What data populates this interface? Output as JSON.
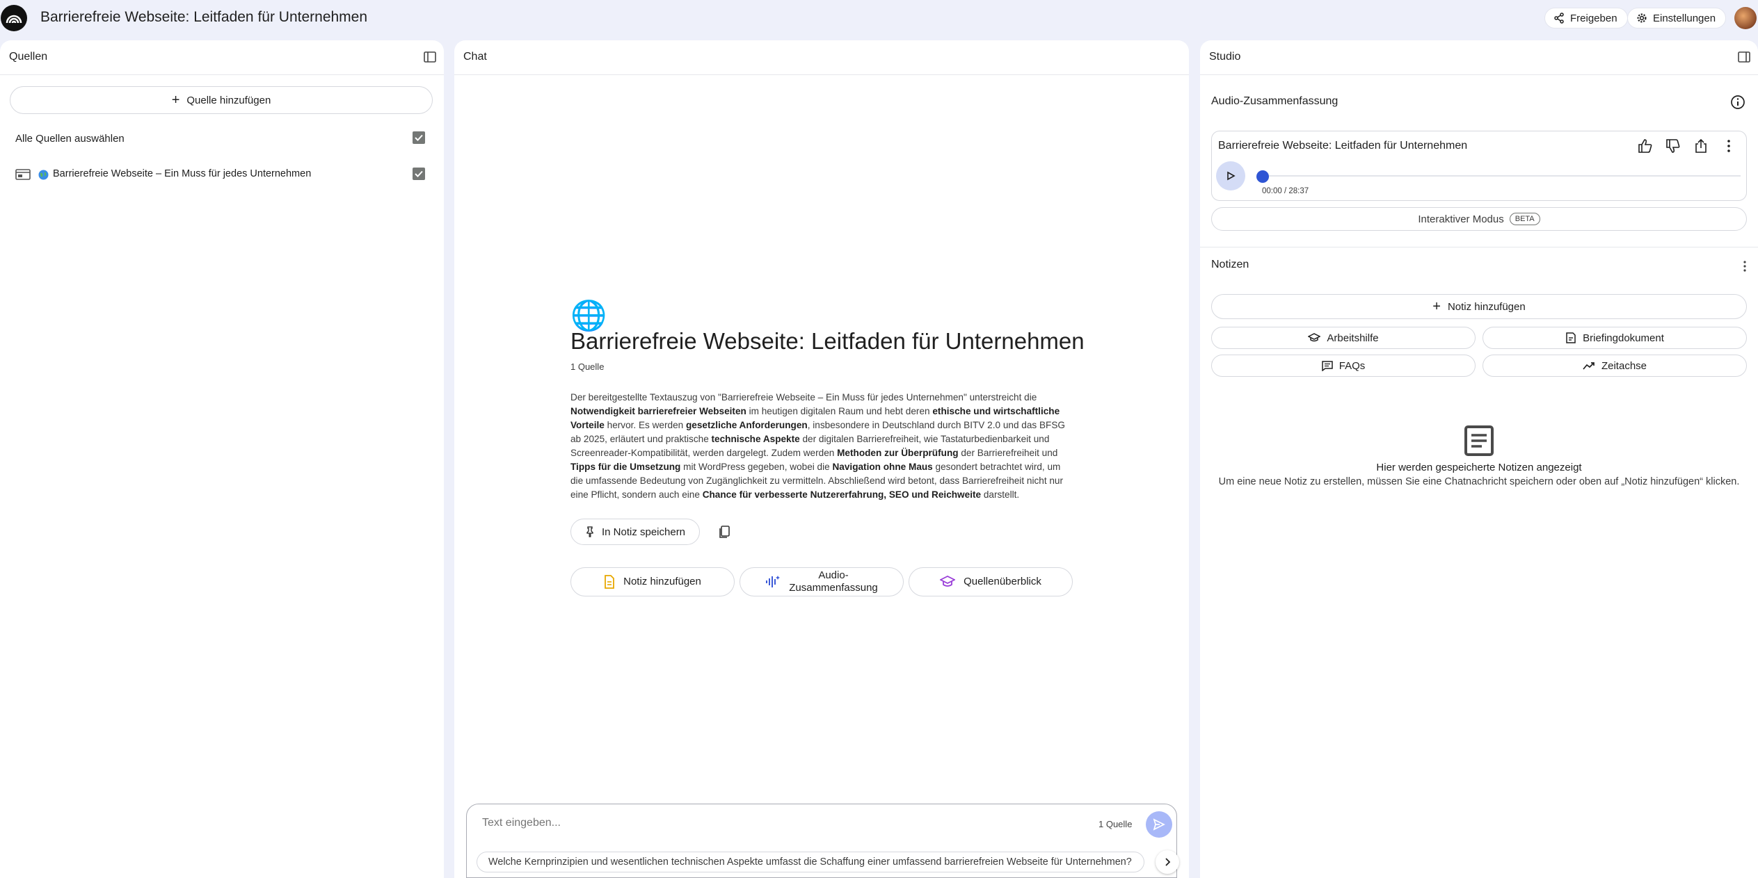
{
  "header": {
    "title": "Barrierefreie Webseite: Leitfaden für Unternehmen",
    "share_label": "Freigeben",
    "settings_label": "Einstellungen"
  },
  "sources": {
    "title": "Quellen",
    "add_label": "Quelle hinzufügen",
    "select_all_label": "Alle Quellen auswählen",
    "items": [
      {
        "label": "Barrierefreie Webseite – Ein Muss für jedes Unternehmen",
        "checked": true
      }
    ]
  },
  "chat": {
    "title": "Chat",
    "notebook_title": "Barrierefreie Webseite: Leitfaden für Unternehmen",
    "source_count": "1 Quelle",
    "summary_parts": [
      {
        "t": "Der bereitgestellte Textauszug von \"Barrierefreie Webseite – Ein Muss für jedes Unternehmen\" unterstreicht die ",
        "b": false
      },
      {
        "t": "Notwendigkeit barrierefreier Webseiten",
        "b": true
      },
      {
        "t": " im heutigen digitalen Raum und hebt deren ",
        "b": false
      },
      {
        "t": "ethische und wirtschaftliche Vorteile",
        "b": true
      },
      {
        "t": " hervor. Es werden ",
        "b": false
      },
      {
        "t": "gesetzliche Anforderungen",
        "b": true
      },
      {
        "t": ", insbesondere in Deutschland durch BITV 2.0 und das BFSG ab 2025, erläutert und praktische ",
        "b": false
      },
      {
        "t": "technische Aspekte",
        "b": true
      },
      {
        "t": " der digitalen Barrierefreiheit, wie Tastaturbedienbarkeit und Screenreader-Kompatibilität, werden dargelegt. Zudem werden ",
        "b": false
      },
      {
        "t": "Methoden zur Überprüfung",
        "b": true
      },
      {
        "t": " der Barrierefreiheit und ",
        "b": false
      },
      {
        "t": "Tipps für die Umsetzung",
        "b": true
      },
      {
        "t": " mit WordPress gegeben, wobei die ",
        "b": false
      },
      {
        "t": "Navigation ohne Maus",
        "b": true
      },
      {
        "t": " gesondert betrachtet wird, um die umfassende Bedeutung von Zugänglichkeit zu vermitteln. Abschließend wird betont, dass Barrierefreiheit nicht nur eine Pflicht, sondern auch eine ",
        "b": false
      },
      {
        "t": "Chance für verbesserte Nutzererfahrung, SEO und Reichweite",
        "b": true
      },
      {
        "t": " darstellt.",
        "b": false
      }
    ],
    "save_note_label": "In Notiz speichern",
    "actions": {
      "add_note": "Notiz hinzufügen",
      "audio_line1": "Audio-",
      "audio_line2": "Zusammenfassung",
      "overview": "Quellenüberblick"
    },
    "input_placeholder": "Text eingeben...",
    "input_source_count": "1 Quelle",
    "suggestion": "Welche Kernprinzipien und wesentlichen technischen Aspekte umfasst die Schaffung einer umfassend barrierefreien Webseite für Unternehmen?"
  },
  "studio": {
    "title": "Studio",
    "audio_section_title": "Audio-Zusammenfassung",
    "audio_card_title": "Barrierefreie Webseite: Leitfaden für Unternehmen",
    "audio_time": "00:00 / 28:37",
    "audio_progress": 0,
    "interactive_label": "Interaktiver Modus",
    "beta_label": "BETA",
    "notes_title": "Notizen",
    "add_note_label": "Notiz hinzufügen",
    "study_guide_label": "Arbeitshilfe",
    "briefing_label": "Briefingdokument",
    "faq_label": "FAQs",
    "timeline_label": "Zeitachse",
    "empty_title": "Hier werden gespeicherte Notizen angezeigt",
    "empty_text": "Um eine neue Notiz zu erstellen, müssen Sie eine Chatnachricht speichern oder oben auf „Notiz hinzufügen“ klicken."
  },
  "colors": {
    "background": "#eef0fa",
    "accent": "#2f55d4",
    "send_button": "#a8b8f8"
  }
}
